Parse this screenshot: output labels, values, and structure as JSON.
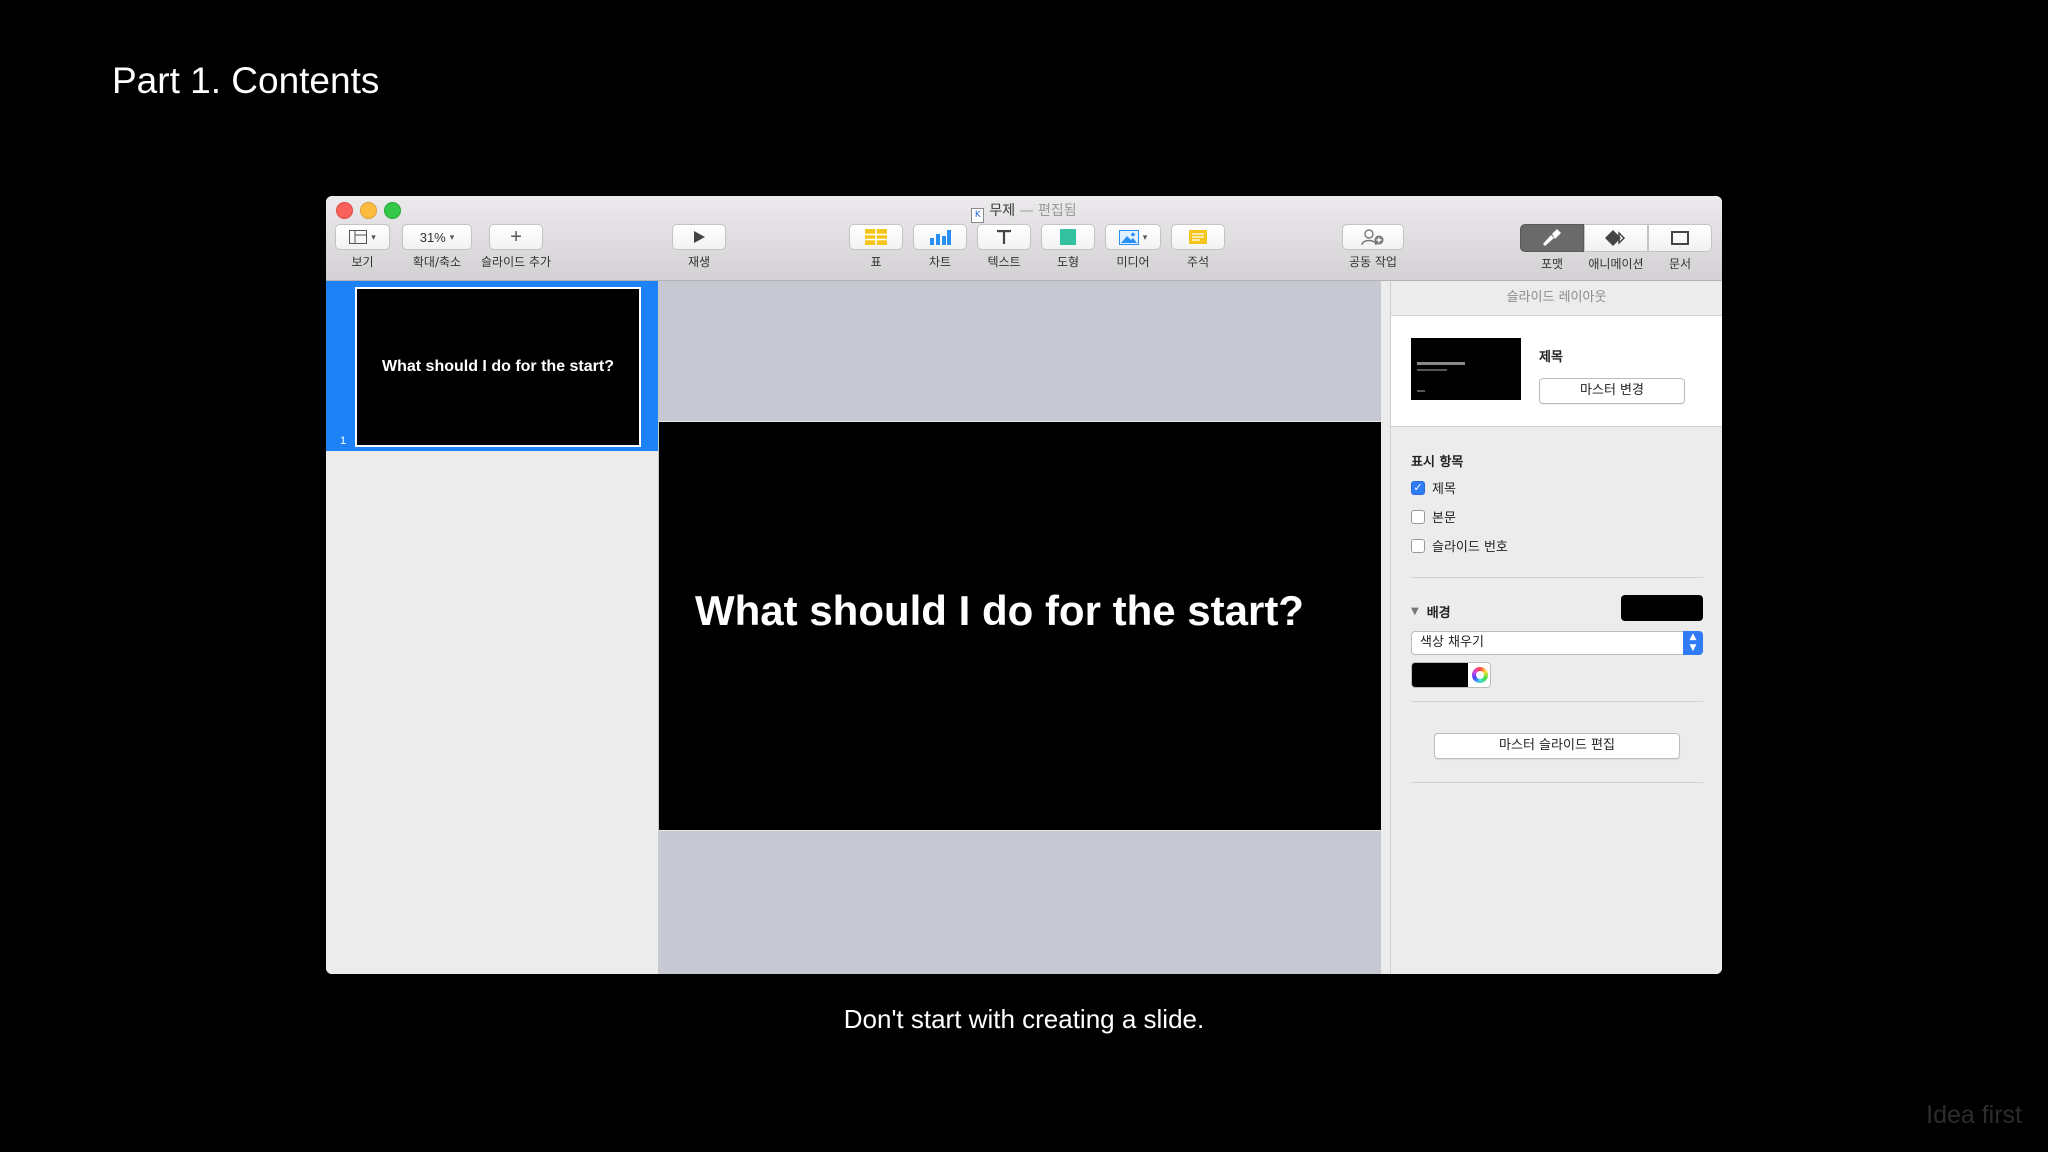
{
  "slide_page": {
    "title": "Part 1. Contents",
    "caption": "Don't start with creating a slide.",
    "watermark": "Idea first"
  },
  "window": {
    "title": "무제",
    "title_suffix": "— 편집됨"
  },
  "toolbar": {
    "view_label": "보기",
    "zoom_value": "31%",
    "zoom_label": "확대/축소",
    "add_slide_label": "슬라이드 추가",
    "play_label": "재생",
    "table_label": "표",
    "chart_label": "차트",
    "text_label": "텍스트",
    "shape_label": "도형",
    "media_label": "미디어",
    "comment_label": "주석",
    "collaborate_label": "공동 작업",
    "format_label": "포맷",
    "animate_label": "애니메이션",
    "document_label": "문서"
  },
  "navigator": {
    "slide_number": "1",
    "slide_thumb_text": "What should I do for the start?"
  },
  "canvas": {
    "slide_title": "What should I do for the start?"
  },
  "inspector": {
    "header": "슬라이드 레이아웃",
    "layout_name": "제목",
    "change_master_label": "마스터 변경",
    "show_section": "표시 항목",
    "checkboxes": [
      {
        "label": "제목",
        "checked": true
      },
      {
        "label": "본문",
        "checked": false
      },
      {
        "label": "슬라이드 번호",
        "checked": false
      }
    ],
    "background_section": "배경",
    "fill_type": "색상 채우기",
    "edit_master_label": "마스터 슬라이드 편집",
    "background_color": "#000000"
  },
  "colors": {
    "selection_blue": "#1e82f7",
    "canvas_gray": "#c6c8d2",
    "checkbox_blue": "#2f7cf6"
  }
}
